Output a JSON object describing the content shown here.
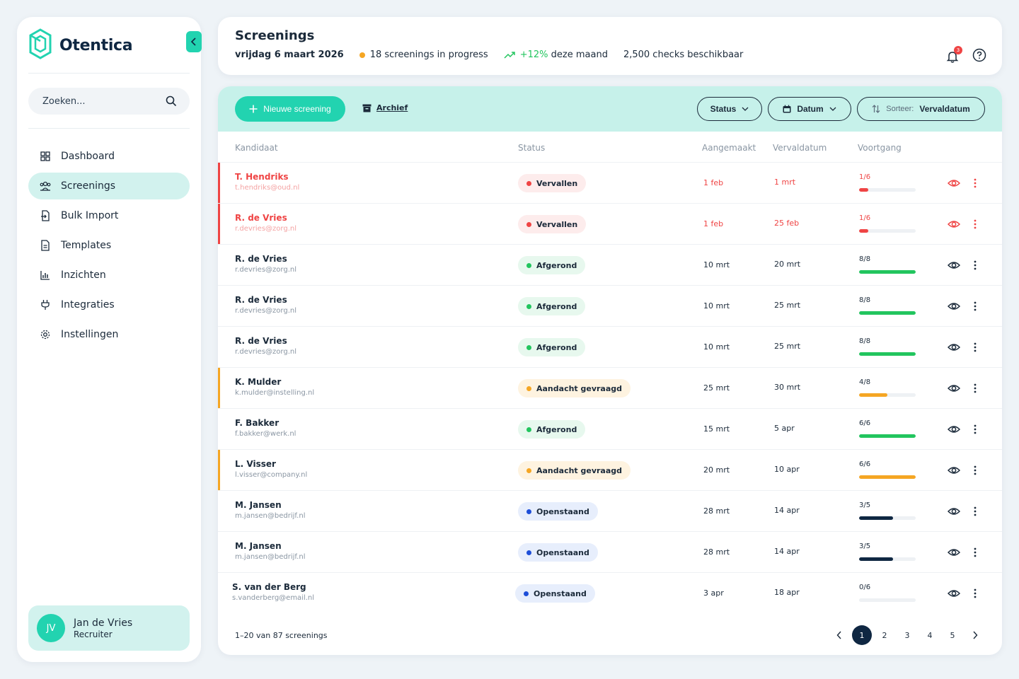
{
  "brand": {
    "name": "Otentica"
  },
  "sidebar": {
    "search_placeholder": "Zoeken...",
    "items": [
      {
        "label": "Dashboard",
        "icon": "grid-icon"
      },
      {
        "label": "Screenings",
        "icon": "users-icon",
        "active": true
      },
      {
        "label": "Bulk Import",
        "icon": "import-icon"
      },
      {
        "label": "Templates",
        "icon": "document-icon"
      },
      {
        "label": "Inzichten",
        "icon": "bar-chart-icon"
      },
      {
        "label": "Integraties",
        "icon": "plug-icon"
      },
      {
        "label": "Instellingen",
        "icon": "gear-icon"
      }
    ],
    "user": {
      "initials": "JV",
      "name": "Jan de Vries",
      "role": "Recruiter"
    }
  },
  "header": {
    "title": "Screenings",
    "date": "vrijdag 6 maart 2026",
    "in_progress": "18 screenings in progress",
    "trend_value": "+12%",
    "trend_suffix": "deze maand",
    "checks": "2,500 checks beschikbaar",
    "notification_count": "3"
  },
  "toolbar": {
    "new_label": "Nieuwe screening",
    "archive_label": "Archief",
    "status_label": "Status",
    "date_label": "Datum",
    "sort_prefix": "Sorteer:",
    "sort_value": "Vervaldatum"
  },
  "table": {
    "headers": {
      "candidate": "Kandidaat",
      "status": "Status",
      "created": "Aangemaakt",
      "due": "Vervaldatum",
      "progress": "Voortgang"
    },
    "rows": [
      {
        "name": "T. Hendriks",
        "email": "t.hendriks@oud.nl",
        "status": "Vervallen",
        "kind": "expired",
        "created": "1 feb",
        "due": "1 mrt",
        "progress": "1/6",
        "fraction": 0.167
      },
      {
        "name": "R. de Vries",
        "email": "r.devries@zorg.nl",
        "status": "Vervallen",
        "kind": "expired",
        "created": "1 feb",
        "due": "25 feb",
        "progress": "1/6",
        "fraction": 0.167
      },
      {
        "name": "R. de Vries",
        "email": "r.devries@zorg.nl",
        "status": "Afgerond",
        "kind": "done",
        "created": "10 mrt",
        "due": "20 mrt",
        "progress": "8/8",
        "fraction": 1
      },
      {
        "name": "R. de Vries",
        "email": "r.devries@zorg.nl",
        "status": "Afgerond",
        "kind": "done",
        "created": "10 mrt",
        "due": "25 mrt",
        "progress": "8/8",
        "fraction": 1
      },
      {
        "name": "R. de Vries",
        "email": "r.devries@zorg.nl",
        "status": "Afgerond",
        "kind": "done",
        "created": "10 mrt",
        "due": "25 mrt",
        "progress": "8/8",
        "fraction": 1
      },
      {
        "name": "K. Mulder",
        "email": "k.mulder@instelling.nl",
        "status": "Aandacht gevraagd",
        "kind": "attention",
        "created": "25 mrt",
        "due": "30 mrt",
        "progress": "4/8",
        "fraction": 0.5
      },
      {
        "name": "F. Bakker",
        "email": "f.bakker@werk.nl",
        "status": "Afgerond",
        "kind": "done",
        "created": "15 mrt",
        "due": "5 apr",
        "progress": "6/6",
        "fraction": 1
      },
      {
        "name": "L. Visser",
        "email": "l.visser@company.nl",
        "status": "Aandacht gevraagd",
        "kind": "attention",
        "created": "20 mrt",
        "due": "10 apr",
        "progress": "6/6",
        "fraction": 1
      },
      {
        "name": "M. Jansen",
        "email": "m.jansen@bedrijf.nl",
        "status": "Openstaand",
        "kind": "open",
        "created": "28 mrt",
        "due": "14 apr",
        "progress": "3/5",
        "fraction": 0.6
      },
      {
        "name": "M. Jansen",
        "email": "m.jansen@bedrijf.nl",
        "status": "Openstaand",
        "kind": "open",
        "created": "28 mrt",
        "due": "14 apr",
        "progress": "3/5",
        "fraction": 0.6
      },
      {
        "name": "S. van der Berg",
        "email": "s.vanderberg@email.nl",
        "status": "Openstaand",
        "kind": "open",
        "created": "3 apr",
        "due": "18 apr",
        "progress": "0/6",
        "fraction": 0
      }
    ]
  },
  "footer": {
    "range": "1–20 van 87 screenings",
    "pages": [
      "1",
      "2",
      "3",
      "4",
      "5"
    ],
    "current_page": "1"
  },
  "colors": {
    "accent": "#22d3b0",
    "navy": "#0f2742",
    "expired": "#ef4444",
    "done": "#22c55e",
    "attention": "#f5a623",
    "open": "#1d4ed8"
  }
}
